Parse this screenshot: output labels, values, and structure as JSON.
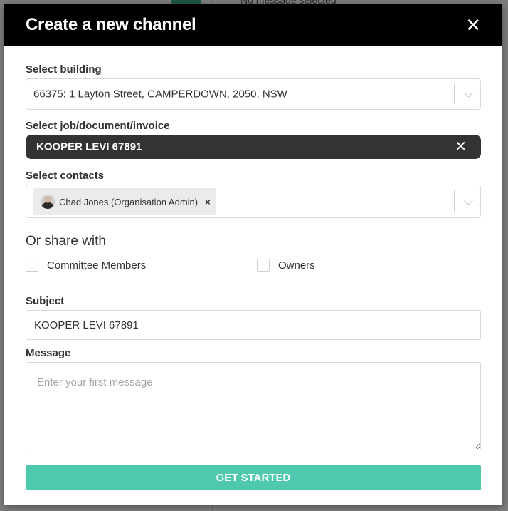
{
  "background": {
    "preview_text": "No message selected"
  },
  "modal": {
    "title": "Create a new channel",
    "close_icon": "close-icon"
  },
  "building": {
    "label": "Select building",
    "value": "66375: 1 Layton Street, CAMPERDOWN, 2050, NSW"
  },
  "job": {
    "label": "Select job/document/invoice",
    "value": "KOOPER LEVI 67891",
    "remove_glyph": "✕"
  },
  "contacts": {
    "label": "Select contacts",
    "selected": [
      {
        "name": "Chad Jones (Organisation Admin)",
        "remove_glyph": "×"
      }
    ]
  },
  "share": {
    "heading": "Or share with",
    "options": [
      {
        "label": "Committee Members",
        "checked": false
      },
      {
        "label": "Owners",
        "checked": false
      }
    ]
  },
  "subject": {
    "label": "Subject",
    "value": "KOOPER LEVI 67891"
  },
  "message": {
    "label": "Message",
    "placeholder": "Enter your first message",
    "value": ""
  },
  "submit": {
    "label": "GET STARTED"
  },
  "colors": {
    "header_bg": "#000000",
    "submit_bg": "#4fc9ae",
    "pill_bg": "#333333"
  }
}
